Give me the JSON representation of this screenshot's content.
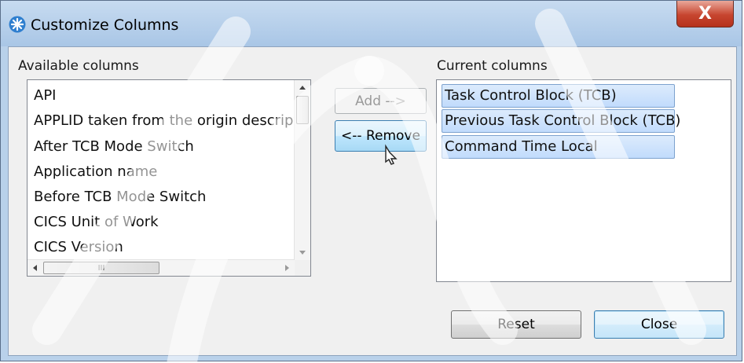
{
  "window": {
    "title": "Customize Columns",
    "close_label": "X"
  },
  "available": {
    "label": "Available columns",
    "items": [
      "API",
      "APPLID taken from the origin descripto",
      "After TCB Mode Switch",
      "Application name",
      "Before TCB Mode Switch",
      "CICS Unit of Work",
      "CICS Version"
    ],
    "hscroll_thumb_glyph": "III"
  },
  "buttons": {
    "add": "Add -->",
    "remove": "<-- Remove",
    "reset": "Reset",
    "close": "Close"
  },
  "current": {
    "label": "Current columns",
    "items": [
      "Task Control Block (TCB)",
      "Previous Task Control Block (TCB)",
      "Command Time Local"
    ]
  },
  "icons": {
    "app": "asterisk-icon",
    "cursor": "pointer-cursor-icon"
  },
  "colors": {
    "titlebar": "#b9d1ea",
    "selection": "#c1dbfc",
    "close_button": "#c7452f"
  }
}
